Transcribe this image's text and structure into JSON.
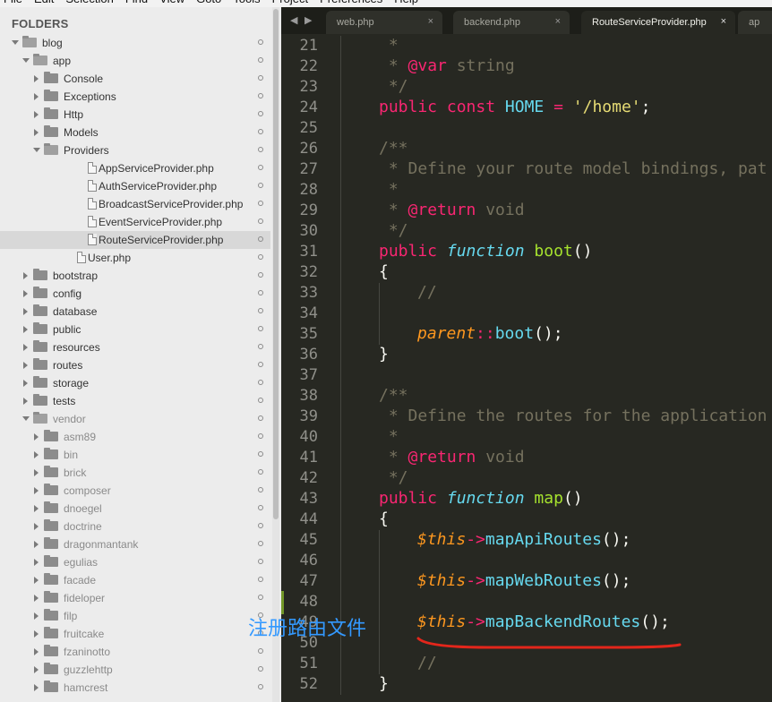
{
  "menu": [
    "File",
    "Edit",
    "Selection",
    "Find",
    "View",
    "Goto",
    "Tools",
    "Project",
    "Preferences",
    "Help"
  ],
  "sidebar": {
    "title": "FOLDERS",
    "tree": [
      {
        "label": "blog",
        "type": "folder",
        "depth": 0,
        "expanded": true
      },
      {
        "label": "app",
        "type": "folder",
        "depth": 1,
        "expanded": true
      },
      {
        "label": "Console",
        "type": "folder",
        "depth": 2,
        "expanded": false
      },
      {
        "label": "Exceptions",
        "type": "folder",
        "depth": 2,
        "expanded": false
      },
      {
        "label": "Http",
        "type": "folder",
        "depth": 2,
        "expanded": false
      },
      {
        "label": "Models",
        "type": "folder",
        "depth": 2,
        "expanded": false
      },
      {
        "label": "Providers",
        "type": "folder",
        "depth": 2,
        "expanded": true
      },
      {
        "label": "AppServiceProvider.php",
        "type": "file",
        "depth": 3
      },
      {
        "label": "AuthServiceProvider.php",
        "type": "file",
        "depth": 3
      },
      {
        "label": "BroadcastServiceProvider.php",
        "type": "file",
        "depth": 3
      },
      {
        "label": "EventServiceProvider.php",
        "type": "file",
        "depth": 3
      },
      {
        "label": "RouteServiceProvider.php",
        "type": "file",
        "depth": 3,
        "selected": true
      },
      {
        "label": "User.php",
        "type": "file",
        "depth": 2
      },
      {
        "label": "bootstrap",
        "type": "folder",
        "depth": 1,
        "expanded": false
      },
      {
        "label": "config",
        "type": "folder",
        "depth": 1,
        "expanded": false
      },
      {
        "label": "database",
        "type": "folder",
        "depth": 1,
        "expanded": false
      },
      {
        "label": "public",
        "type": "folder",
        "depth": 1,
        "expanded": false
      },
      {
        "label": "resources",
        "type": "folder",
        "depth": 1,
        "expanded": false
      },
      {
        "label": "routes",
        "type": "folder",
        "depth": 1,
        "expanded": false
      },
      {
        "label": "storage",
        "type": "folder",
        "depth": 1,
        "expanded": false
      },
      {
        "label": "tests",
        "type": "folder",
        "depth": 1,
        "expanded": false
      },
      {
        "label": "vendor",
        "type": "folder",
        "depth": 1,
        "expanded": true,
        "dim": true
      },
      {
        "label": "asm89",
        "type": "folder",
        "depth": 2,
        "expanded": false,
        "dim": true
      },
      {
        "label": "bin",
        "type": "folder",
        "depth": 2,
        "expanded": false,
        "dim": true
      },
      {
        "label": "brick",
        "type": "folder",
        "depth": 2,
        "expanded": false,
        "dim": true
      },
      {
        "label": "composer",
        "type": "folder",
        "depth": 2,
        "expanded": false,
        "dim": true
      },
      {
        "label": "dnoegel",
        "type": "folder",
        "depth": 2,
        "expanded": false,
        "dim": true
      },
      {
        "label": "doctrine",
        "type": "folder",
        "depth": 2,
        "expanded": false,
        "dim": true
      },
      {
        "label": "dragonmantank",
        "type": "folder",
        "depth": 2,
        "expanded": false,
        "dim": true
      },
      {
        "label": "egulias",
        "type": "folder",
        "depth": 2,
        "expanded": false,
        "dim": true
      },
      {
        "label": "facade",
        "type": "folder",
        "depth": 2,
        "expanded": false,
        "dim": true
      },
      {
        "label": "fideloper",
        "type": "folder",
        "depth": 2,
        "expanded": false,
        "dim": true
      },
      {
        "label": "filp",
        "type": "folder",
        "depth": 2,
        "expanded": false,
        "dim": true
      },
      {
        "label": "fruitcake",
        "type": "folder",
        "depth": 2,
        "expanded": false,
        "dim": true
      },
      {
        "label": "fzaninotto",
        "type": "folder",
        "depth": 2,
        "expanded": false,
        "dim": true
      },
      {
        "label": "guzzlehttp",
        "type": "folder",
        "depth": 2,
        "expanded": false,
        "dim": true
      },
      {
        "label": "hamcrest",
        "type": "folder",
        "depth": 2,
        "expanded": false,
        "dim": true
      }
    ]
  },
  "tabs": [
    {
      "label": "web.php",
      "close": "×",
      "active": false
    },
    {
      "label": "backend.php",
      "close": "×",
      "active": false
    },
    {
      "label": "RouteServiceProvider.php",
      "close": "×",
      "active": true
    },
    {
      "label": "ap",
      "close": "",
      "active": false
    }
  ],
  "tab_nav": "◀ ▶",
  "code_lines": [
    {
      "n": "21",
      "indent": 1,
      "tokens": [
        {
          "t": " *",
          "c": "comment"
        }
      ]
    },
    {
      "n": "22",
      "indent": 1,
      "tokens": [
        {
          "t": " * ",
          "c": "comment"
        },
        {
          "t": "@var",
          "c": "tag"
        },
        {
          "t": " string",
          "c": "comment"
        }
      ]
    },
    {
      "n": "23",
      "indent": 1,
      "tokens": [
        {
          "t": " */",
          "c": "comment"
        }
      ]
    },
    {
      "n": "24",
      "indent": 1,
      "tokens": [
        {
          "t": "public",
          "c": "kw"
        },
        {
          "t": " ",
          "c": "plain"
        },
        {
          "t": "const",
          "c": "kw"
        },
        {
          "t": " ",
          "c": "plain"
        },
        {
          "t": "HOME",
          "c": "const"
        },
        {
          "t": " = ",
          "c": "kw"
        },
        {
          "t": "'/home'",
          "c": "str"
        },
        {
          "t": ";",
          "c": "plain"
        }
      ]
    },
    {
      "n": "25",
      "indent": 1,
      "tokens": []
    },
    {
      "n": "26",
      "indent": 1,
      "tokens": [
        {
          "t": "/**",
          "c": "comment"
        }
      ]
    },
    {
      "n": "27",
      "indent": 1,
      "tokens": [
        {
          "t": " * Define your route model bindings, pat",
          "c": "comment"
        }
      ]
    },
    {
      "n": "28",
      "indent": 1,
      "tokens": [
        {
          "t": " *",
          "c": "comment"
        }
      ]
    },
    {
      "n": "29",
      "indent": 1,
      "tokens": [
        {
          "t": " * ",
          "c": "comment"
        },
        {
          "t": "@return",
          "c": "tag"
        },
        {
          "t": " void",
          "c": "comment"
        }
      ]
    },
    {
      "n": "30",
      "indent": 1,
      "tokens": [
        {
          "t": " */",
          "c": "comment"
        }
      ]
    },
    {
      "n": "31",
      "indent": 1,
      "tokens": [
        {
          "t": "public",
          "c": "kw"
        },
        {
          "t": " ",
          "c": "plain"
        },
        {
          "t": "function",
          "c": "storage"
        },
        {
          "t": " ",
          "c": "plain"
        },
        {
          "t": "boot",
          "c": "fn"
        },
        {
          "t": "()",
          "c": "plain"
        }
      ]
    },
    {
      "n": "32",
      "indent": 1,
      "tokens": [
        {
          "t": "{",
          "c": "plain"
        }
      ]
    },
    {
      "n": "33",
      "indent": 2,
      "tokens": [
        {
          "t": "//",
          "c": "comment"
        }
      ]
    },
    {
      "n": "34",
      "indent": 2,
      "tokens": []
    },
    {
      "n": "35",
      "indent": 2,
      "tokens": [
        {
          "t": "parent",
          "c": "var"
        },
        {
          "t": "::",
          "c": "kw"
        },
        {
          "t": "boot",
          "c": "call"
        },
        {
          "t": "();",
          "c": "plain"
        }
      ]
    },
    {
      "n": "36",
      "indent": 1,
      "tokens": [
        {
          "t": "}",
          "c": "plain"
        }
      ]
    },
    {
      "n": "37",
      "indent": 1,
      "tokens": []
    },
    {
      "n": "38",
      "indent": 1,
      "tokens": [
        {
          "t": "/**",
          "c": "comment"
        }
      ]
    },
    {
      "n": "39",
      "indent": 1,
      "tokens": [
        {
          "t": " * Define the routes for the application",
          "c": "comment"
        }
      ]
    },
    {
      "n": "40",
      "indent": 1,
      "tokens": [
        {
          "t": " *",
          "c": "comment"
        }
      ]
    },
    {
      "n": "41",
      "indent": 1,
      "tokens": [
        {
          "t": " * ",
          "c": "comment"
        },
        {
          "t": "@return",
          "c": "tag"
        },
        {
          "t": " void",
          "c": "comment"
        }
      ]
    },
    {
      "n": "42",
      "indent": 1,
      "tokens": [
        {
          "t": " */",
          "c": "comment"
        }
      ]
    },
    {
      "n": "43",
      "indent": 1,
      "tokens": [
        {
          "t": "public",
          "c": "kw"
        },
        {
          "t": " ",
          "c": "plain"
        },
        {
          "t": "function",
          "c": "storage"
        },
        {
          "t": " ",
          "c": "plain"
        },
        {
          "t": "map",
          "c": "fn"
        },
        {
          "t": "()",
          "c": "plain"
        }
      ]
    },
    {
      "n": "44",
      "indent": 1,
      "tokens": [
        {
          "t": "{",
          "c": "plain"
        }
      ]
    },
    {
      "n": "45",
      "indent": 2,
      "tokens": [
        {
          "t": "$this",
          "c": "var"
        },
        {
          "t": "->",
          "c": "kw"
        },
        {
          "t": "mapApiRoutes",
          "c": "call"
        },
        {
          "t": "();",
          "c": "plain"
        }
      ]
    },
    {
      "n": "46",
      "indent": 2,
      "tokens": []
    },
    {
      "n": "47",
      "indent": 2,
      "tokens": [
        {
          "t": "$this",
          "c": "var"
        },
        {
          "t": "->",
          "c": "kw"
        },
        {
          "t": "mapWebRoutes",
          "c": "call"
        },
        {
          "t": "();",
          "c": "plain"
        }
      ]
    },
    {
      "n": "48",
      "indent": 2,
      "tokens": []
    },
    {
      "n": "49",
      "indent": 2,
      "tokens": [
        {
          "t": "$this",
          "c": "var"
        },
        {
          "t": "->",
          "c": "kw"
        },
        {
          "t": "mapBackendRoutes",
          "c": "call"
        },
        {
          "t": "();",
          "c": "plain"
        }
      ]
    },
    {
      "n": "50",
      "indent": 2,
      "tokens": []
    },
    {
      "n": "51",
      "indent": 2,
      "tokens": [
        {
          "t": "//",
          "c": "comment"
        }
      ]
    },
    {
      "n": "52",
      "indent": 1,
      "tokens": [
        {
          "t": "}",
          "c": "plain"
        }
      ]
    }
  ],
  "annotation": {
    "text": "注册路由文件",
    "color": "#3399ff",
    "underline_color": "#e3261b"
  },
  "colors": {
    "editor_bg": "#272822",
    "keyword": "#f92672",
    "function": "#a6e22e",
    "string": "#e6db74",
    "variable": "#fd971f",
    "storage": "#66d9ef",
    "comment": "#75715e"
  }
}
